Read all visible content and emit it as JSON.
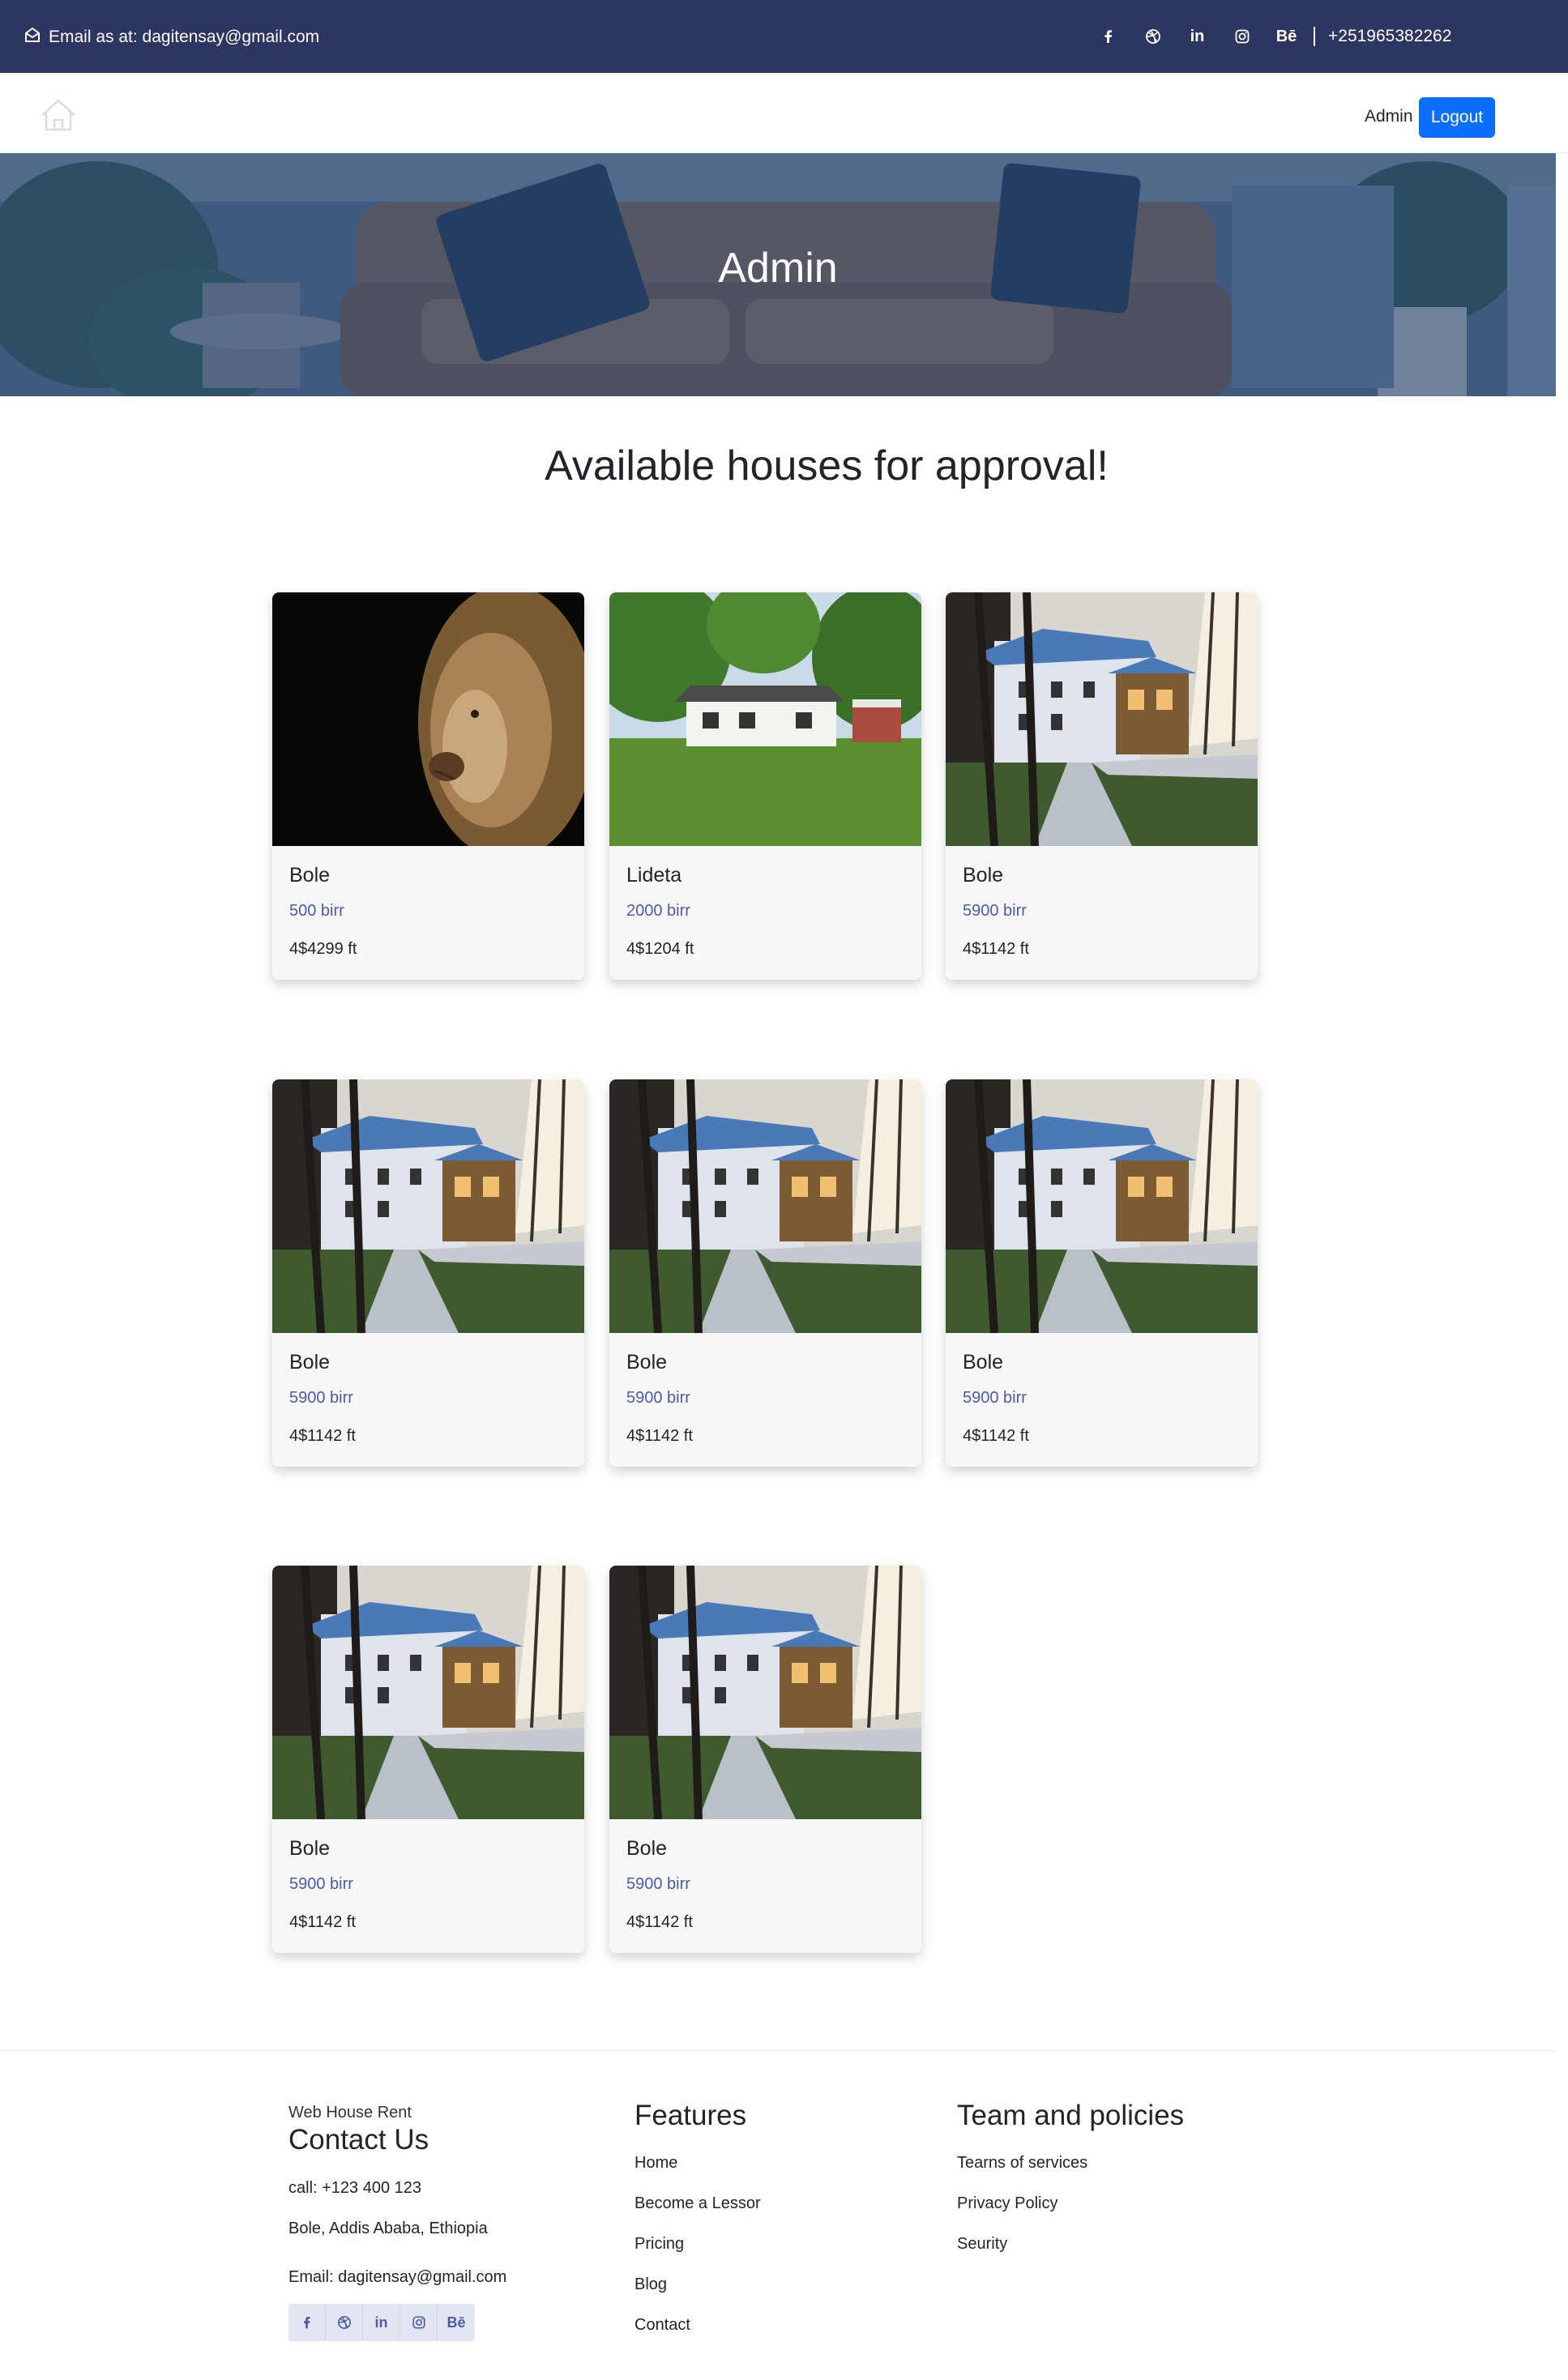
{
  "topbar": {
    "email": "Email as at: dagitensay@gmail.com",
    "social": [
      "facebook-icon",
      "dribbble-icon",
      "linkedin-icon",
      "instagram-icon",
      "behance-icon"
    ],
    "behance_text": "Bē",
    "linkedin_text": "in",
    "phone": "+251965382262",
    "bg_color": "#2d3561"
  },
  "nav": {
    "admin_label": "Admin",
    "logout_label": "Logout",
    "logout_color": "#0d6efd"
  },
  "hero": {
    "title": "Admin"
  },
  "section": {
    "title": "Available houses for approval!"
  },
  "cards": [
    {
      "image": "lion-photo",
      "location": "Bole",
      "price": "500 birr",
      "area": "4$4299 ft"
    },
    {
      "image": "white-house-photo",
      "location": "Lideta",
      "price": "2000 birr",
      "area": "4$1204 ft"
    },
    {
      "image": "villa-photo",
      "location": "Bole",
      "price": "5900 birr",
      "area": "4$1142 ft"
    },
    {
      "image": "villa-photo",
      "location": "Bole",
      "price": "5900 birr",
      "area": "4$1142 ft"
    },
    {
      "image": "villa-photo",
      "location": "Bole",
      "price": "5900 birr",
      "area": "4$1142 ft"
    },
    {
      "image": "villa-photo",
      "location": "Bole",
      "price": "5900 birr",
      "area": "4$1142 ft"
    },
    {
      "image": "villa-photo",
      "location": "Bole",
      "price": "5900 birr",
      "area": "4$1142 ft"
    },
    {
      "image": "villa-photo",
      "location": "Bole",
      "price": "5900 birr",
      "area": "4$1142 ft"
    }
  ],
  "footer": {
    "brand": "Web House Rent",
    "contact_title": "Contact Us",
    "call": "call: +123 400 123",
    "address": "Bole, Addis Ababa, Ethiopia",
    "email": "Email: dagitensay@gmail.com",
    "features_title": "Features",
    "features": [
      "Home",
      "Become a Lessor",
      "Pricing",
      "Blog",
      "Contact"
    ],
    "policies_title": "Team and policies",
    "policies": [
      "Tearns of services",
      "Privacy Policy",
      "Seurity"
    ]
  }
}
